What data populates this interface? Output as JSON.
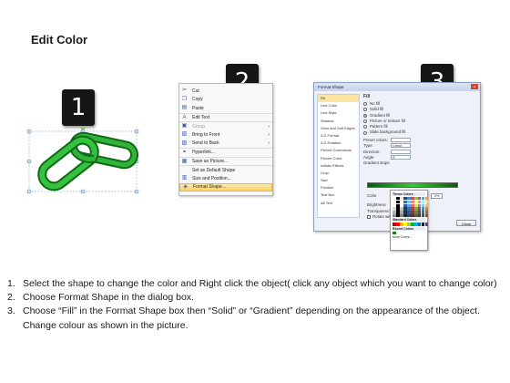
{
  "page": {
    "title": "Edit Color"
  },
  "badges": [
    "1",
    "2",
    "3"
  ],
  "context_menu": {
    "items": [
      {
        "icon": "cut-icon",
        "glyph": "✂",
        "label": "Cut",
        "state": "normal"
      },
      {
        "icon": "copy-icon",
        "glyph": "❐",
        "label": "Copy",
        "state": "normal"
      },
      {
        "icon": "paste-icon",
        "glyph": "▤",
        "label": "Paste",
        "state": "normal"
      },
      {
        "icon": "edit-text-icon",
        "glyph": "A",
        "label": "Edit Text",
        "state": "normal",
        "sep": true
      },
      {
        "icon": "group-icon",
        "glyph": "▣",
        "label": "Group",
        "state": "dim",
        "sep": true,
        "sub": true
      },
      {
        "icon": "bring-front-icon",
        "glyph": "▧",
        "label": "Bring to Front",
        "state": "normal",
        "sub": true
      },
      {
        "icon": "send-back-icon",
        "glyph": "▨",
        "label": "Send to Back",
        "state": "normal",
        "sub": true
      },
      {
        "icon": "hyperlink-icon",
        "glyph": "⚭",
        "label": "Hyperlink...",
        "state": "normal",
        "sep": true
      },
      {
        "icon": "save-picture-icon",
        "glyph": "▦",
        "label": "Save as Picture...",
        "state": "normal",
        "sep": true
      },
      {
        "icon": "default-shape-icon",
        "glyph": "",
        "label": "Set as Default Shape",
        "state": "normal",
        "sep": true
      },
      {
        "icon": "size-position-icon",
        "glyph": "▥",
        "label": "Size and Position...",
        "state": "normal"
      },
      {
        "icon": "format-shape-icon",
        "glyph": "◈",
        "label": "Format Shape...",
        "state": "highlight"
      }
    ]
  },
  "dialog": {
    "title": "Format Shape",
    "close_glyph": "x",
    "sidebar": [
      "Fill",
      "Line Color",
      "Line Style",
      "Shadow",
      "Glow and Soft Edges",
      "3-D Format",
      "3-D Rotation",
      "Picture Corrections",
      "Picture Color",
      "Artistic Effects",
      "Crop",
      "Size",
      "Position",
      "Text Box",
      "Alt Text"
    ],
    "fill_heading": "Fill",
    "fill_options": [
      {
        "label": "No fill",
        "on": false
      },
      {
        "label": "Solid fill",
        "on": false
      },
      {
        "label": "Gradient fill",
        "on": true
      },
      {
        "label": "Picture or texture fill",
        "on": false
      },
      {
        "label": "Pattern fill",
        "on": false
      },
      {
        "label": "Slide background fill",
        "on": false
      }
    ],
    "fields": [
      {
        "label": "Preset colors:",
        "value": ""
      },
      {
        "label": "Type:",
        "value": "Linear"
      },
      {
        "label": "Direction:",
        "value": ""
      },
      {
        "label": "Angle:",
        "value": "0°"
      }
    ],
    "gradient_stops_label": "Gradient stops",
    "color_label": "Color",
    "position_label": "Position:",
    "position_value": "0%",
    "brightness_label": "Brightness",
    "transparency_label": "Transparency",
    "rotate_label": "Rotate with shape",
    "close_button": "Close"
  },
  "palette": {
    "theme_label": "Theme Colors",
    "standard_label": "Standard Colors",
    "recent_label": "Recent Colors",
    "more_label": "More Colors...",
    "theme_top": [
      "#ffffff",
      "#000000",
      "#eeece1",
      "#1f497d",
      "#4f81bd",
      "#c0504d",
      "#9bbb59",
      "#8064a2",
      "#4bacc6",
      "#f79646"
    ],
    "standard": [
      "#c00000",
      "#ff0000",
      "#ffc000",
      "#ffff00",
      "#92d050",
      "#00b050",
      "#00b0f0",
      "#0070c0",
      "#002060",
      "#7030a0"
    ],
    "recent": [
      "#1a7a1a"
    ]
  },
  "instructions": [
    {
      "num": "1.",
      "text": "Select the shape to change the color and Right click the object( click any object which you want to change color)"
    },
    {
      "num": "2.",
      "text": "Choose Format Shape in the dialog box."
    },
    {
      "num": "3.",
      "text": "Choose “Fill” in the Format Shape box then “Solid” or “Gradient” depending on the appearance of the object. Change colour as shown in the picture."
    }
  ]
}
